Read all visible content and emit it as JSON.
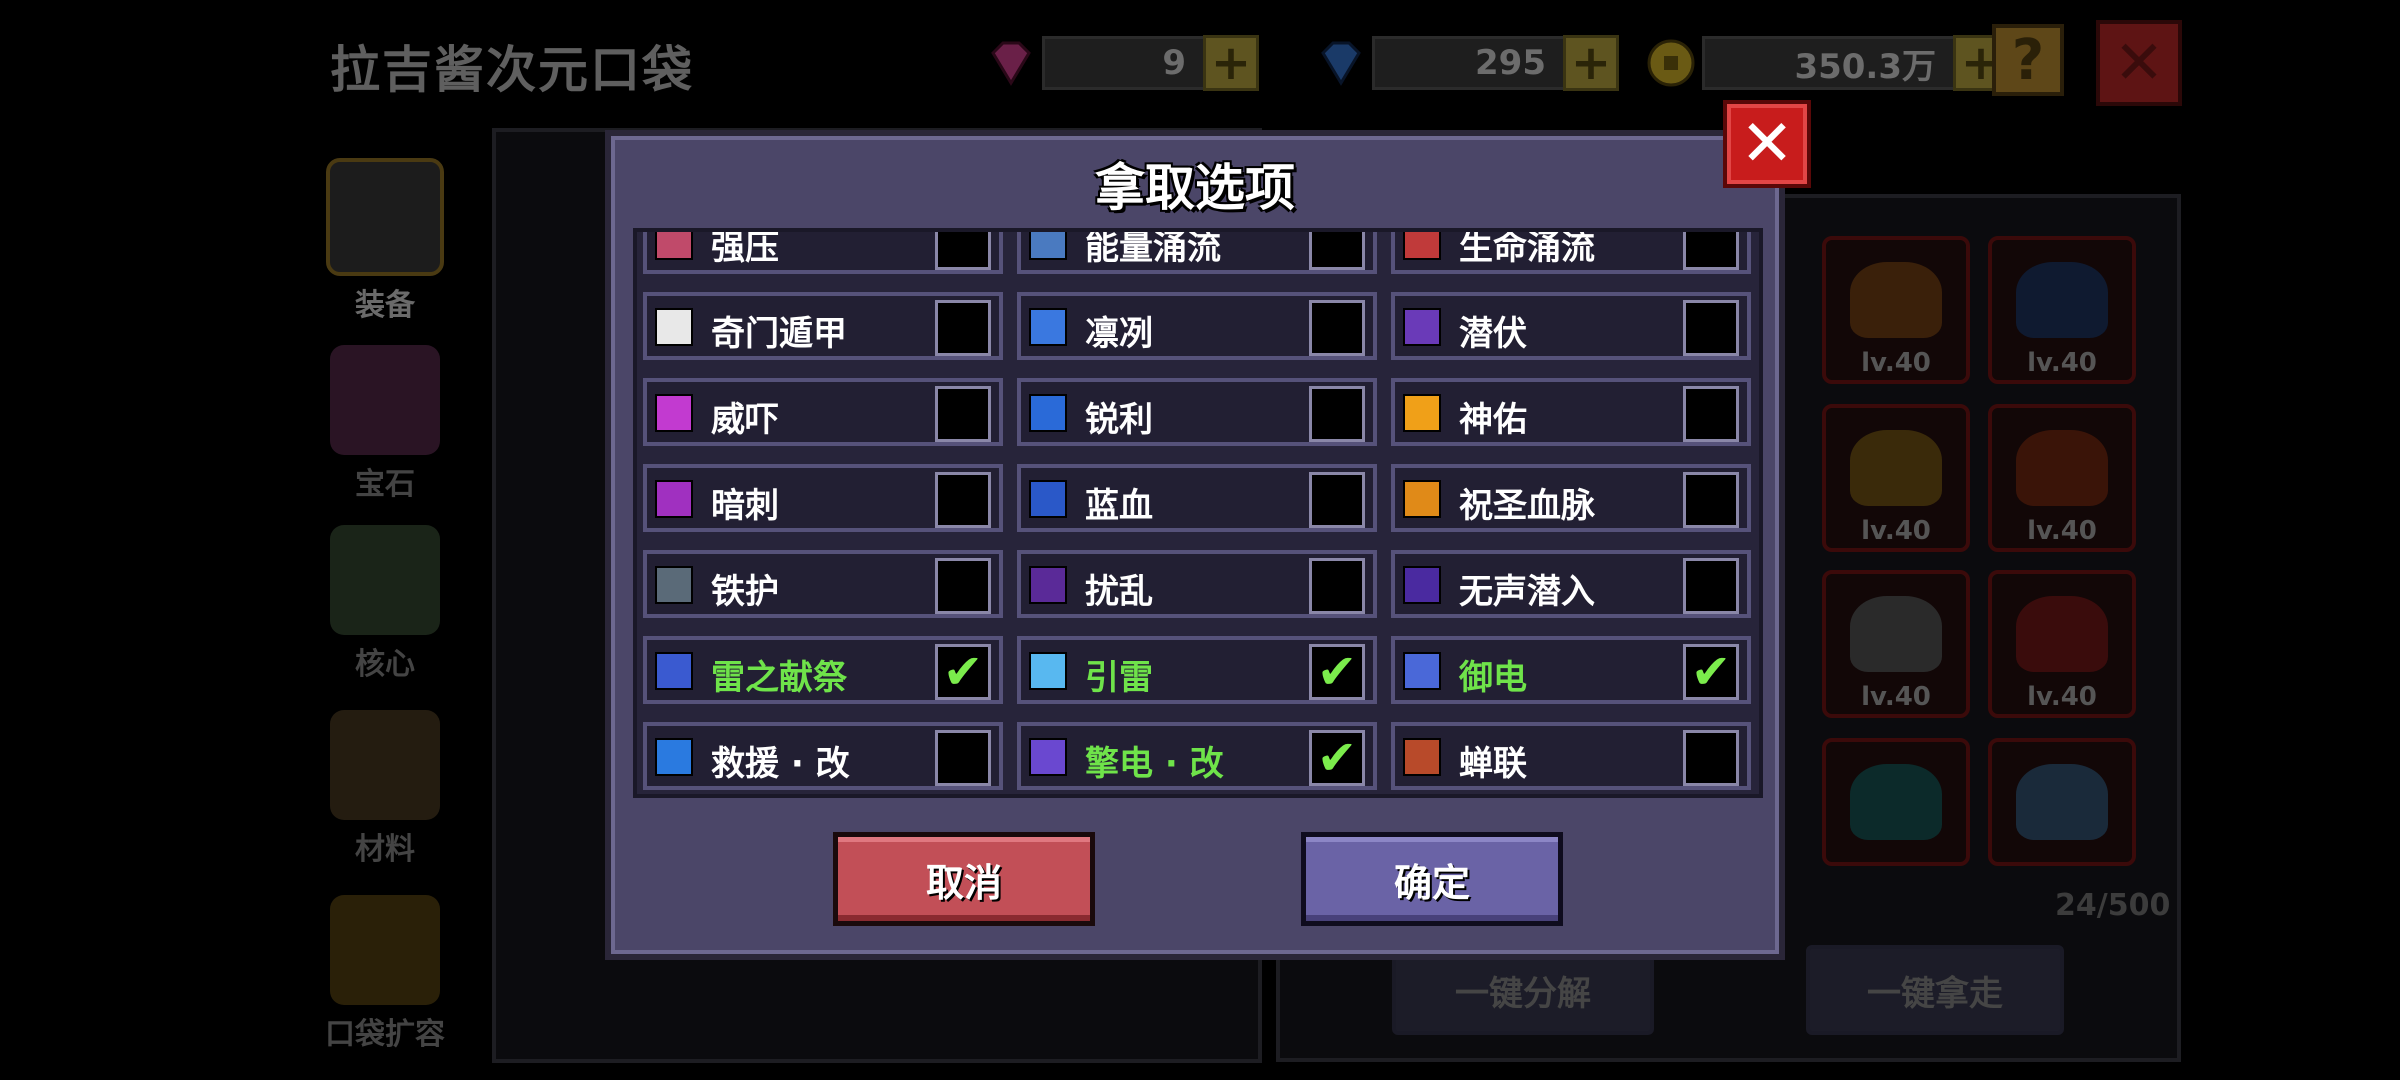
{
  "background": {
    "title": "拉吉酱次元口袋",
    "currencies": [
      {
        "icon": "pink-gem-icon",
        "value": "9",
        "color": "#7a2a55"
      },
      {
        "icon": "blue-gem-icon",
        "value": "295",
        "color": "#1f4a7a"
      },
      {
        "icon": "gold-coin-icon",
        "value": "350.3万",
        "color": "#8a7416"
      }
    ],
    "plus_label": "+",
    "help_label": "?",
    "close_label": "✕",
    "sidebar": [
      {
        "label": "装备",
        "icon": "armor-icon"
      },
      {
        "label": "宝石",
        "icon": "gem-icon"
      },
      {
        "label": "核心",
        "icon": "core-icon"
      },
      {
        "label": "材料",
        "icon": "material-icon"
      },
      {
        "label": "口袋扩容",
        "icon": "chest-expand-icon"
      }
    ],
    "bag_count": "24/500",
    "bulk_buttons": [
      "一键分解",
      "一键拿走"
    ],
    "item_levels": [
      "lv.40",
      "lv.40",
      "lv.40",
      "lv.40",
      "lv.40",
      "lv.40"
    ]
  },
  "dialog": {
    "title": "拿取选项",
    "close_label": "✕",
    "cancel_label": "取消",
    "confirm_label": "确定",
    "check_mark": "✔",
    "rows": [
      [
        {
          "label": "强压",
          "checked": false,
          "icon_color": "#c04a6a"
        },
        {
          "label": "能量涌流",
          "checked": false,
          "icon_color": "#4a7ac0"
        },
        {
          "label": "生命涌流",
          "checked": false,
          "icon_color": "#c03a3a"
        }
      ],
      [
        {
          "label": "奇门遁甲",
          "checked": false,
          "icon_color": "#e8e8e8"
        },
        {
          "label": "凛冽",
          "checked": false,
          "icon_color": "#3a78e0"
        },
        {
          "label": "潜伏",
          "checked": false,
          "icon_color": "#6a3ab8"
        }
      ],
      [
        {
          "label": "威吓",
          "checked": false,
          "icon_color": "#c23ad0"
        },
        {
          "label": "锐利",
          "checked": false,
          "icon_color": "#2a6ad8"
        },
        {
          "label": "神佑",
          "checked": false,
          "icon_color": "#f0a018"
        }
      ],
      [
        {
          "label": "暗刺",
          "checked": false,
          "icon_color": "#a030c0"
        },
        {
          "label": "蓝血",
          "checked": false,
          "icon_color": "#2a58c8"
        },
        {
          "label": "祝圣血脉",
          "checked": false,
          "icon_color": "#e08a18"
        }
      ],
      [
        {
          "label": "铁护",
          "checked": false,
          "icon_color": "#5a6a78"
        },
        {
          "label": "扰乱",
          "checked": false,
          "icon_color": "#5a2a98"
        },
        {
          "label": "无声潜入",
          "checked": false,
          "icon_color": "#4a2aa0"
        }
      ],
      [
        {
          "label": "雷之献祭",
          "checked": true,
          "icon_color": "#3a5ad0"
        },
        {
          "label": "引雷",
          "checked": true,
          "icon_color": "#58b8f0"
        },
        {
          "label": "御电",
          "checked": true,
          "icon_color": "#4a68d8"
        }
      ],
      [
        {
          "label": "救援 · 改",
          "checked": false,
          "icon_color": "#2a7ae0"
        },
        {
          "label": "擎电 · 改",
          "checked": true,
          "icon_color": "#6a48d0"
        },
        {
          "label": "蝉联",
          "checked": false,
          "icon_color": "#b84a2a"
        }
      ]
    ]
  }
}
